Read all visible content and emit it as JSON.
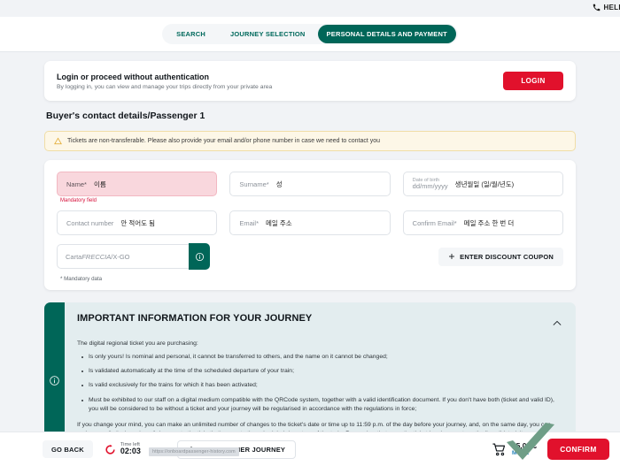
{
  "utility": {
    "help_label": "HELP",
    "phone_icon": "phone-icon"
  },
  "stepper": {
    "steps": [
      {
        "label": "SEARCH",
        "active": false
      },
      {
        "label": "JOURNEY SELECTION",
        "active": false
      },
      {
        "label": "PERSONAL DETAILS AND PAYMENT",
        "active": true
      }
    ]
  },
  "login": {
    "title": "Login or proceed without authentication",
    "subtitle": "By logging in, you can view and manage your trips directly from your private area",
    "button_label": "LOGIN"
  },
  "page_title": "Buyer's contact details/Passenger 1",
  "alert": {
    "icon": "warning-triangle-icon",
    "text": "Tickets are non-transferable. Please also provide your email and/or phone number in case we need to contact you"
  },
  "form": {
    "name": {
      "label": "Name*",
      "value": "이름",
      "error": "Mandatory field"
    },
    "surname": {
      "label": "Surname*",
      "value": "성"
    },
    "dob": {
      "label_top": "Date of birth",
      "label_bottom": "dd/mm/yyyy",
      "value": "생년월일 (일/월/년도)"
    },
    "contact_number": {
      "label": "Contact number",
      "value": "안 적어도 됨"
    },
    "email": {
      "label": "Email*",
      "value": "메일 주소"
    },
    "confirm_email": {
      "label": "Confirm Email*",
      "value": "메일 주소 한 번 더"
    },
    "carta": {
      "prefix": "Carta",
      "italic": "FRECCIA",
      "suffix": "/X-GO",
      "info_icon": "info-circle-icon"
    },
    "coupon_button": "ENTER DISCOUNT COUPON",
    "mandatory_note": "* Mandatory data"
  },
  "info_panel": {
    "rail_icon": "info-circle-icon",
    "title": "IMPORTANT INFORMATION FOR YOUR JOURNEY",
    "collapse_icon": "chevron-up-icon",
    "lead": "The digital regional ticket you are purchasing:",
    "bullets": [
      "Is only yours! Is nominal and personal, it cannot be transferred to others, and the name on it cannot be changed;",
      "Is validated automatically at the time of the scheduled departure of your train;",
      "Is valid exclusively for the trains for which it has been activated;",
      "Must be exhibited to our staff on a digital medium compatible with the QRCode system, together with a valid identification document. If you don't have both (ticket and valid ID), you will be considered to be without a ticket and your journey will be regularised in accordance with the regulations in force;"
    ],
    "paragraph": "If you change your mind, you can make an unlimited number of changes to the ticket's date or time up to 11:59 p.m. of the day before your journey, and, on the same day, you can make an unlimited number of changes to the ticket's time, up to the scheduled departure of the train. Remember that once the ticket has been automatically validated, it can no longer be modified."
  },
  "footer": {
    "go_back": "GO BACK",
    "timer_icon": "timer-icon",
    "timer_label": "Time left",
    "timer_value": "02:03",
    "add_journey": "ADD ANOTHER JOURNEY",
    "cart_icon": "cart-icon",
    "cart_total": "15,00 €",
    "cart_more": "MORE",
    "confirm": "CONFIRM"
  },
  "status_url": "https://onboardpassenger-history.com",
  "colors": {
    "brand_green": "#006658",
    "brand_red": "#e1112c",
    "panel_blue": "#e3edef",
    "alert_yellow": "#fdf7e7",
    "error_pink": "#f9d7dd"
  }
}
